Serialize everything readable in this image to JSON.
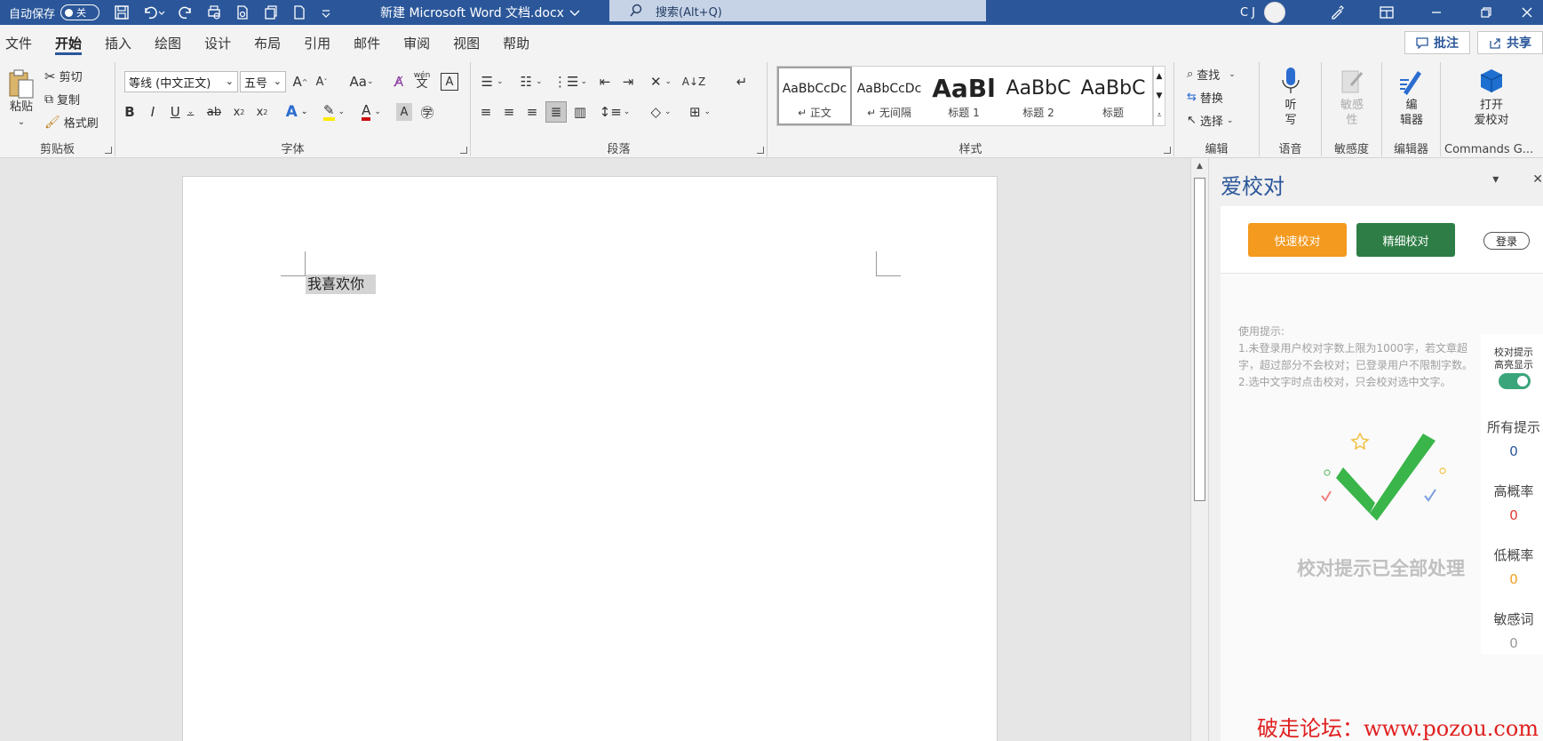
{
  "titlebar": {
    "autosave_label": "自动保存",
    "autosave_state": "关",
    "doc_title": "新建 Microsoft Word 文档.docx",
    "search_placeholder": "搜索(Alt+Q)",
    "user_initials": "C J"
  },
  "tabs": [
    "文件",
    "开始",
    "插入",
    "绘图",
    "设计",
    "布局",
    "引用",
    "邮件",
    "审阅",
    "视图",
    "帮助"
  ],
  "active_tab": "开始",
  "right_buttons": {
    "comments": "批注",
    "share": "共享"
  },
  "ribbon": {
    "clipboard": {
      "paste": "粘贴",
      "cut": "剪切",
      "copy": "复制",
      "format_painter": "格式刷",
      "label": "剪贴板"
    },
    "font": {
      "font_name": "等线 (中文正文)",
      "font_size": "五号",
      "label": "字体",
      "phonetic": "wén"
    },
    "paragraph": {
      "label": "段落"
    },
    "styles": {
      "label": "样式",
      "items": [
        {
          "sample": "AaBbCcDc",
          "name": "↵ 正文"
        },
        {
          "sample": "AaBbCcDc",
          "name": "↵ 无间隔"
        },
        {
          "sample": "AaBl",
          "name": "标题 1"
        },
        {
          "sample": "AaBbC",
          "name": "标题 2"
        },
        {
          "sample": "AaBbC",
          "name": "标题"
        }
      ]
    },
    "editing": {
      "find": "查找",
      "replace": "替换",
      "select": "选择",
      "label": "编辑"
    },
    "voice": {
      "dictate": "听\n写",
      "label": "语音"
    },
    "sensitivity": {
      "btn": "敏感\n性",
      "label": "敏感度"
    },
    "editor": {
      "btn": "编\n辑器",
      "label": "编辑器"
    },
    "commands": {
      "btn": "打开\n爱校对",
      "label": "Commands G..."
    }
  },
  "document": {
    "text": "我喜欢你"
  },
  "panel": {
    "title": "爱校对",
    "quick_check": "快速校对",
    "fine_check": "精细校对",
    "login": "登录",
    "tips": [
      "使用提示:",
      "1.未登录用户校对字数上限为1000字，若文章超",
      "字，超过部分不会校对；已登录用户不限制字数。",
      "2.选中文字时点击校对，只会校对选中文字。"
    ],
    "done": "校对提示已全部处理",
    "highlight_label": "校对提示\n高亮显示",
    "stats": [
      {
        "label": "所有提示",
        "value": "0",
        "color": "#2b579a"
      },
      {
        "label": "高概率",
        "value": "0",
        "color": "#e53935"
      },
      {
        "label": "低概率",
        "value": "0",
        "color": "#f0a020"
      },
      {
        "label": "敏感词",
        "value": "0",
        "color": "#999999"
      }
    ]
  },
  "watermark": "破走论坛：www.pozou.com",
  "colors": {
    "word_blue": "#2b579a",
    "orange": "#f39a1f",
    "green": "#2e7d46"
  }
}
